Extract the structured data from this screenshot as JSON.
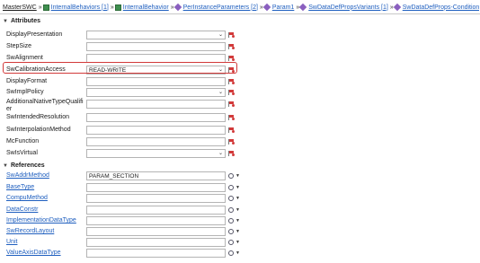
{
  "breadcrumb": [
    {
      "label": "MasterSWC",
      "link": false,
      "icon": "none"
    },
    {
      "label": "InternalBehaviors [1]",
      "link": true,
      "icon": "component-icon"
    },
    {
      "label": "InternalBehavior",
      "link": true,
      "icon": "behavior-icon"
    },
    {
      "label": "PerInstanceParameters [2]",
      "link": true,
      "icon": "diamond-icon"
    },
    {
      "label": "Param1",
      "link": true,
      "icon": "diamond-icon"
    },
    {
      "label": "SwDataDefPropsVariants [1]",
      "link": true,
      "icon": "diamond-icon"
    },
    {
      "label": "SwDataDefProps-Conditional",
      "link": true,
      "icon": "diamond-icon"
    }
  ],
  "separator": "»",
  "attributes": {
    "title": "Attributes",
    "rows": [
      {
        "label": "DisplayPresentation",
        "value": "",
        "type": "combo"
      },
      {
        "label": "StepSize",
        "value": "",
        "type": "text"
      },
      {
        "label": "SwAlignment",
        "value": "",
        "type": "text"
      },
      {
        "label": "SwCalibrationAccess",
        "value": "READ-WRITE",
        "type": "combo"
      },
      {
        "label": "DisplayFormat",
        "value": "",
        "type": "text"
      },
      {
        "label": "SwImplPolicy",
        "value": "",
        "type": "combo"
      },
      {
        "label": "AdditionalNativeTypeQualifier",
        "value": "",
        "type": "text"
      },
      {
        "label": "SwIntendedResolution",
        "value": "",
        "type": "text"
      },
      {
        "label": "SwInterpolationMethod",
        "value": "",
        "type": "text"
      },
      {
        "label": "McFunction",
        "value": "",
        "type": "text"
      },
      {
        "label": "SwIsVirtual",
        "value": "",
        "type": "combo"
      }
    ]
  },
  "references": {
    "title": "References",
    "rows": [
      {
        "label": "SwAddrMethod",
        "value": "PARAM_SECTION"
      },
      {
        "label": "BaseType",
        "value": ""
      },
      {
        "label": "CompuMethod",
        "value": ""
      },
      {
        "label": "DataConstr",
        "value": ""
      },
      {
        "label": "ImplementationDataType",
        "value": ""
      },
      {
        "label": "SwRecordLayout",
        "value": ""
      },
      {
        "label": "Unit",
        "value": ""
      },
      {
        "label": "ValueAxisDataType",
        "value": ""
      }
    ]
  },
  "colors": {
    "link": "#1f5fbf",
    "highlight": "#d23a3a"
  }
}
